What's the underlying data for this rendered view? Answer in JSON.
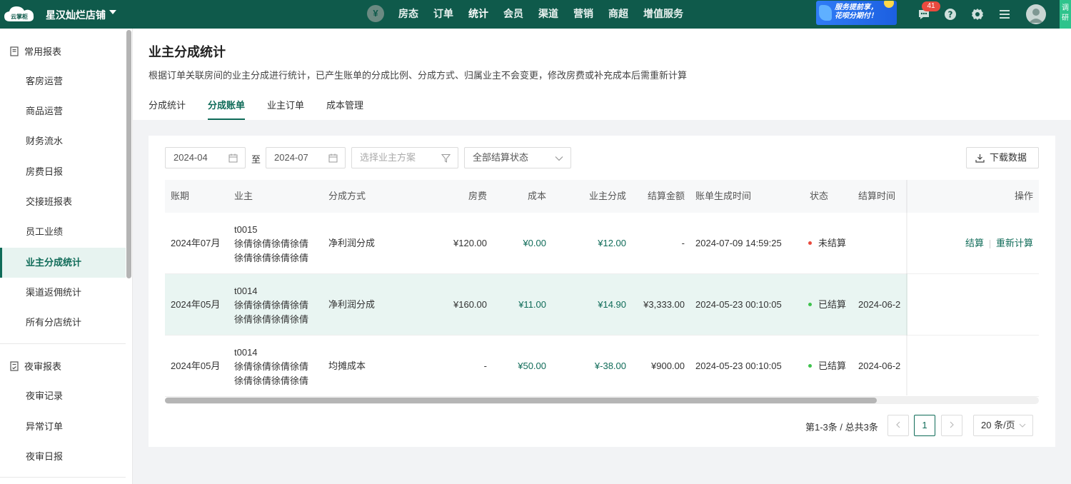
{
  "app": {
    "logo_text": "云掌柜",
    "store_name": "星汉灿烂店铺",
    "nav": [
      "房态",
      "订单",
      "统计",
      "会员",
      "渠道",
      "营销",
      "商超",
      "增值服务"
    ],
    "nav_active": "统计",
    "promo_line1": "服务提前享，",
    "promo_line2": "花呗分期付！",
    "message_count": "41",
    "side_tab": "调研"
  },
  "sidebar": {
    "group1": "常用报表",
    "group1_items": [
      "客房运营",
      "商品运营",
      "财务流水",
      "房费日报",
      "交接班报表",
      "员工业绩",
      "业主分成统计",
      "渠道返佣统计",
      "所有分店统计"
    ],
    "active_item": "业主分成统计",
    "group2": "夜审报表",
    "group2_items": [
      "夜审记录",
      "异常订单",
      "夜审日报"
    ]
  },
  "page": {
    "title": "业主分成统计",
    "description": "根据订单关联房间的业主分成进行统计，已产生账单的分成比例、分成方式、归属业主不会变更，修改房费或补充成本后需重新计算",
    "tabs": [
      "分成统计",
      "分成账单",
      "业主订单",
      "成本管理"
    ],
    "active_tab": "分成账单"
  },
  "filters": {
    "start_month": "2024-04",
    "to_label": "至",
    "end_month": "2024-07",
    "owner_plan_placeholder": "选择业主方案",
    "status_value": "全部结算状态",
    "download_label": "下载数据"
  },
  "table": {
    "headers": {
      "period": "账期",
      "owner": "业主",
      "method": "分成方式",
      "room_fee": "房费",
      "cost": "成本",
      "owner_share": "业主分成",
      "settle_amount": "结算金额",
      "bill_time": "账单生成时间",
      "status": "状态",
      "settle_time": "结算时间",
      "ops": "操作"
    },
    "rows": [
      {
        "period": "2024年07月",
        "owner_code": "t0015",
        "owner_name_1": "徐倩徐倩徐倩徐倩",
        "owner_name_2": "徐倩徐倩徐倩徐倩",
        "method": "净利润分成",
        "room_fee": "¥120.00",
        "cost": "¥0.00",
        "owner_share": "¥12.00",
        "settle_amount": "-",
        "bill_time": "2024-07-09 14:59:25",
        "status": "未结算",
        "status_color": "#e94a3e",
        "settle_time": "",
        "op1": "结算",
        "op2": "重新计算"
      },
      {
        "period": "2024年05月",
        "owner_code": "t0014",
        "owner_name_1": "徐倩徐倩徐倩徐倩",
        "owner_name_2": "徐倩徐倩徐倩徐倩",
        "method": "净利润分成",
        "room_fee": "¥160.00",
        "cost": "¥11.00",
        "owner_share": "¥14.90",
        "settle_amount": "¥3,333.00",
        "bill_time": "2024-05-23 00:10:05",
        "status": "已结算",
        "status_color": "#3ec24d",
        "settle_time": "2024-06-2"
      },
      {
        "period": "2024年05月",
        "owner_code": "t0014",
        "owner_name_1": "徐倩徐倩徐倩徐倩",
        "owner_name_2": "徐倩徐倩徐倩徐倩",
        "method": "均摊成本",
        "room_fee": "-",
        "cost": "¥50.00",
        "owner_share": "¥-38.00",
        "settle_amount": "¥900.00",
        "bill_time": "2024-05-23 00:10:05",
        "status": "已结算",
        "status_color": "#3ec24d",
        "settle_time": "2024-06-2"
      }
    ]
  },
  "pagination": {
    "total_text": "第1-3条 / 总共3条",
    "current_page": "1",
    "page_size": "20 条/页"
  },
  "colors": {
    "brand": "#0f5a4b",
    "accent": "#0f6b58",
    "highlight_row": "#e9f5f2"
  }
}
